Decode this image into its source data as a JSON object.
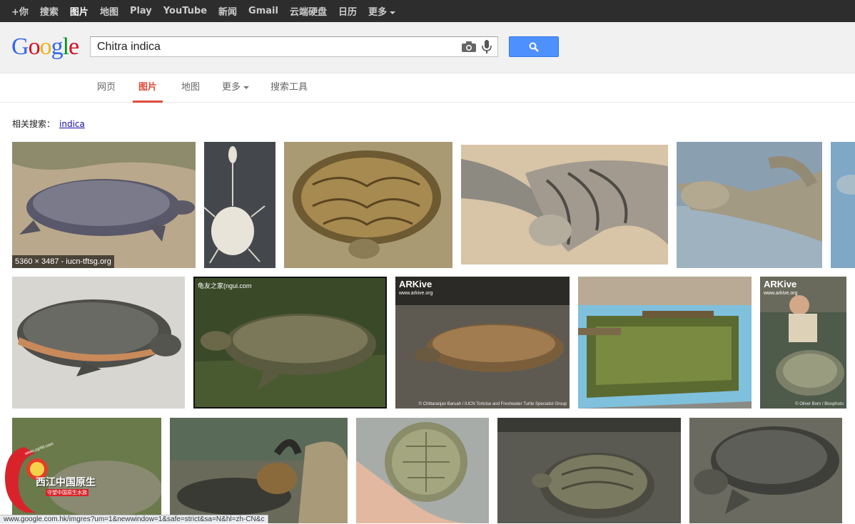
{
  "topbar": {
    "items": [
      "+你",
      "搜索",
      "图片",
      "地图",
      "Play",
      "YouTube",
      "新闻",
      "Gmail",
      "云端硬盘",
      "日历",
      "更多"
    ]
  },
  "logo": {
    "text": "Google"
  },
  "search": {
    "value": "Chitra indica"
  },
  "tabs": [
    "网页",
    "图片",
    "地图",
    "更多",
    "搜索工具"
  ],
  "related": {
    "label": "相关搜索：",
    "link": "indica"
  },
  "results": {
    "first_caption": "5360 × 3487 - iucn-tftsg.org",
    "watermark_2": "龟友之家(ngui.com",
    "arkive_name": "ARKive",
    "arkive_url": "www.arkive.org",
    "credit_8": "© Chittaranjan Baruah / IUCN Tortoise and Freshwater Turtle Specialist Group",
    "credit_10": "© Oliver Born / Biosphoto"
  },
  "site_logo": {
    "line1": "西江中国原生",
    "line2": "守望中国原生水族",
    "url": "www.cqnfd.com"
  },
  "status": {
    "url": "www.google.com.hk/imgres?um=1&newwindow=1&safe=strict&sa=N&hl=zh-CN&c"
  },
  "colors": {
    "accent": "#dd4b39",
    "button": "#4d90fe",
    "link": "#1a0dab"
  }
}
